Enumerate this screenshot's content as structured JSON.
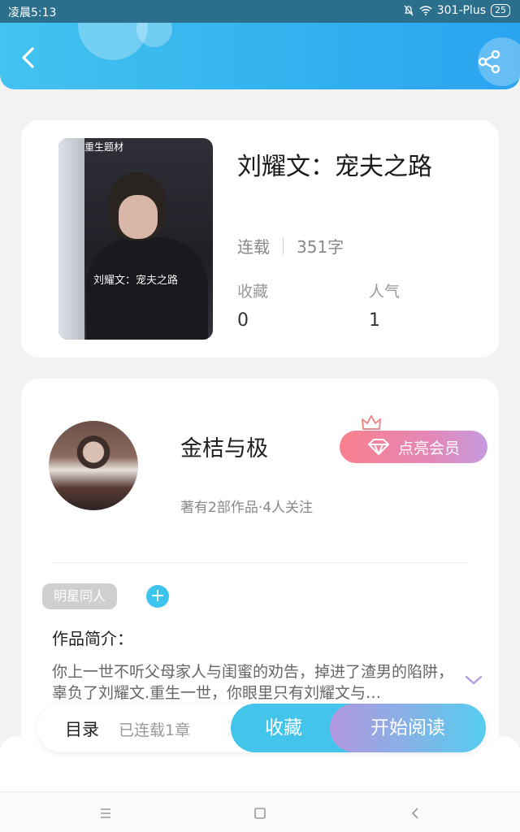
{
  "status_bar": {
    "time": "凌晨5:13",
    "carrier": "301-Plus",
    "battery": "25"
  },
  "header": {
    "back_icon": "chevron-left-icon",
    "share_icon": "share-icon"
  },
  "book": {
    "title": "刘耀文：宠夫之路",
    "cover_tag": "重生题材",
    "cover_caption": "刘耀文：宠夫之路",
    "status": "连载",
    "word_count": "351字",
    "collect_label": "收藏",
    "collect_value": "0",
    "popularity_label": "人气",
    "popularity_value": "1"
  },
  "author": {
    "name": "金桔与极",
    "meta": "著有2部作品·4人关注",
    "vip_label": "点亮会员"
  },
  "tags": {
    "chip": "明星同人",
    "add": "+"
  },
  "intro": {
    "label": "作品简介：",
    "text": "你上一世不听父母家人与闺蜜的劝告，掉进了渣男的陷阱，辜负了刘耀文.重生一世，你眼里只有刘耀文与…"
  },
  "actions": {
    "toc_label": "目录",
    "toc_meta": "已连载1章",
    "favorite_label": "收藏",
    "read_label": "开始阅读"
  },
  "colors": {
    "accent": "#43c4ea",
    "vip": "#f8808d"
  }
}
